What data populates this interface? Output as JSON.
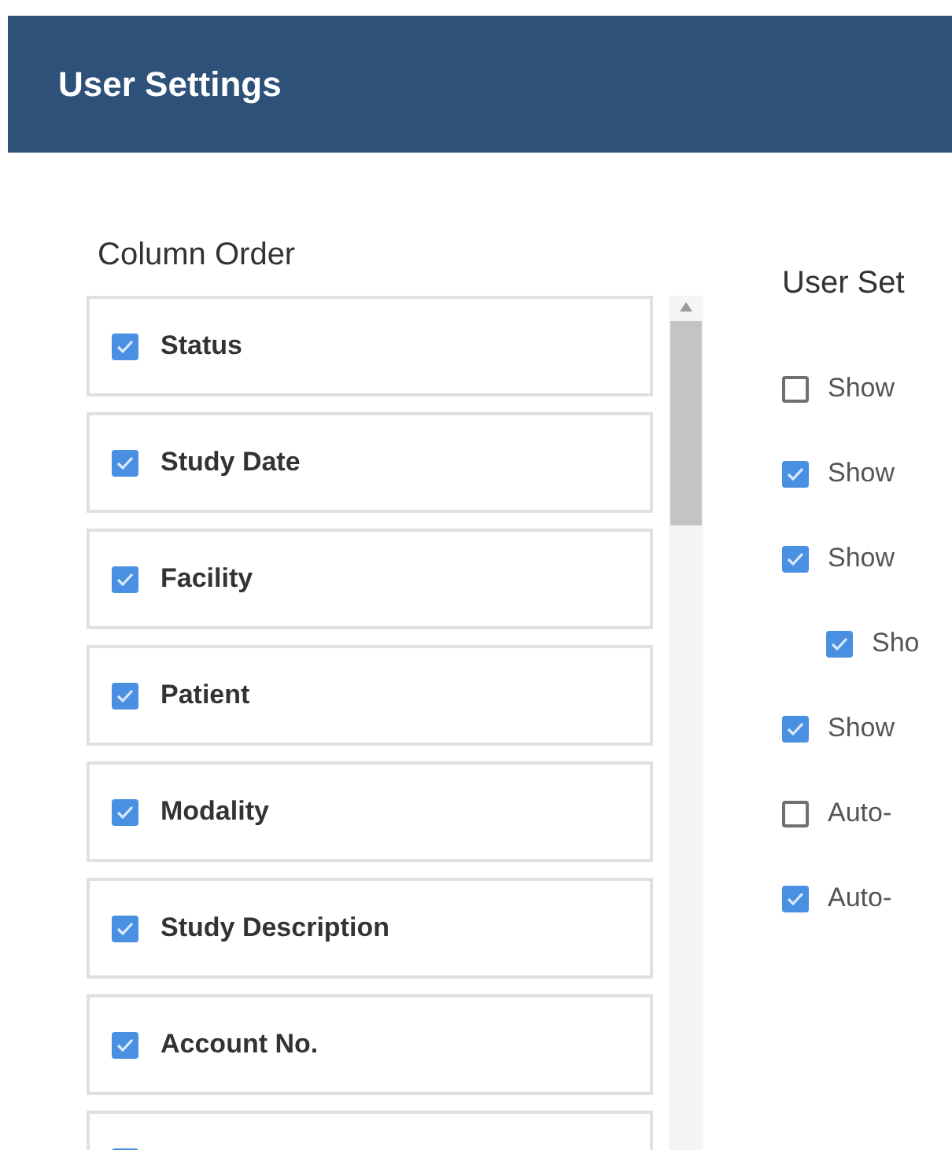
{
  "header": {
    "title": "User Settings"
  },
  "column_order": {
    "title": "Column Order",
    "items": [
      {
        "label": "Status",
        "checked": true
      },
      {
        "label": "Study Date",
        "checked": true
      },
      {
        "label": "Facility",
        "checked": true
      },
      {
        "label": "Patient",
        "checked": true
      },
      {
        "label": "Modality",
        "checked": true
      },
      {
        "label": "Study Description",
        "checked": true
      },
      {
        "label": "Account No.",
        "checked": true
      },
      {
        "checked": true
      }
    ]
  },
  "user_settings": {
    "title": "User Set",
    "options": [
      {
        "label": "Show",
        "checked": false
      },
      {
        "label": "Show",
        "checked": true
      },
      {
        "label": "Show",
        "checked": true,
        "children": [
          {
            "label": "Sho",
            "checked": true
          }
        ]
      },
      {
        "label": "Show",
        "checked": true
      },
      {
        "label": "Auto-",
        "checked": false
      },
      {
        "label": "Auto-",
        "checked": true
      }
    ]
  }
}
